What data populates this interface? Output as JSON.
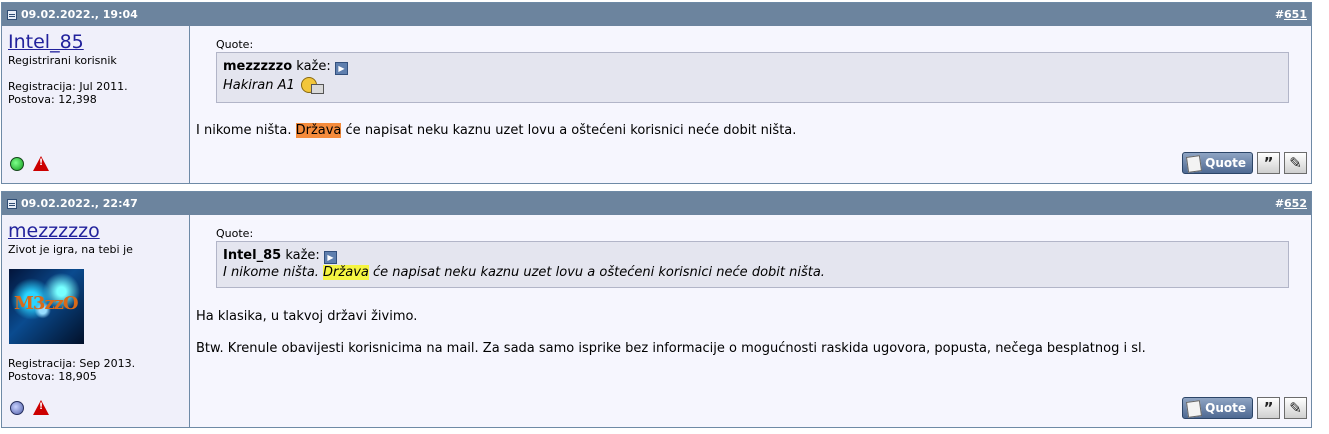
{
  "posts": [
    {
      "date": "09.02.2022., 19:04",
      "number": "651",
      "author": "Intel_85",
      "user_title": "Registrirani korisnik",
      "registration": "Registracija: Jul 2011.",
      "posts_count": "Postova: 12,398",
      "quote_label": "Quote:",
      "quote_author": "mezzzzzo",
      "quote_says": "kaže:",
      "quote_text": "Hakiran A1",
      "message_before": "I nikome ništa. ",
      "message_highlight": "Država",
      "message_after": " će napisat neku kaznu uzet lovu a oštećeni korisnici neće dobit ništa.",
      "status": "online",
      "quote_button": "Quote"
    },
    {
      "date": "09.02.2022., 22:47",
      "number": "652",
      "author": "mezzzzzo",
      "user_title": "Zivot je igra, na tebi je",
      "avatar_text": "M3zzO",
      "registration": "Registracija: Sep 2013.",
      "posts_count": "Postova: 18,905",
      "quote_label": "Quote:",
      "quote_author": "Intel_85",
      "quote_says": "kaže:",
      "quote_before": "I nikome ništa. ",
      "quote_highlight": "Država",
      "quote_after": " će napisat neku kaznu uzet lovu a oštećeni korisnici neće dobit ništa.",
      "message_line1": "Ha klasika, u takvoj državi živimo.",
      "message_line2": "Btw. Krenule obavijesti korisnicima na mail. Za sada samo isprike bez informacije o mogućnosti raskida ugovora, popusta, nečega besplatnog i sl.",
      "status": "offline",
      "quote_button": "Quote"
    }
  ],
  "colors": {
    "header_bg": "#6c849e",
    "username": "#22229c",
    "highlight_post1": "#f48b3c",
    "highlight_post2": "#f5f542"
  },
  "icons": {
    "post_icon": "document-icon",
    "goto": "goto-post-icon",
    "smiley": "computer-smiley-icon",
    "online": "online-status-icon",
    "offline": "offline-status-icon",
    "report": "report-warning-icon",
    "multiquote": "multiquote-icon",
    "edit": "edit-icon"
  }
}
